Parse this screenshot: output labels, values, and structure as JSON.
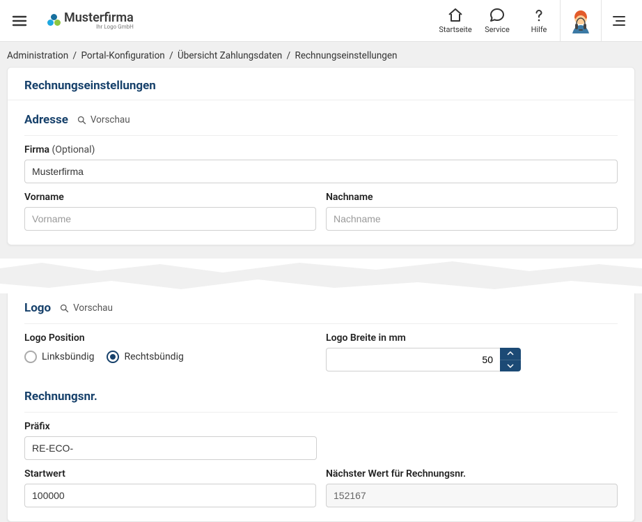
{
  "header": {
    "brand_name": "Musterfirma",
    "brand_sub": "Ihr Logo GmbH",
    "nav": {
      "home": "Startseite",
      "service": "Service",
      "help": "Hilfe"
    }
  },
  "breadcrumb": {
    "items": [
      "Administration",
      "Portal-Konfiguration",
      "Übersicht Zahlungsdaten",
      "Rechnungseinstellungen"
    ]
  },
  "page": {
    "title": "Rechnungseinstellungen",
    "preview_label": "Vorschau",
    "adresse": {
      "title": "Adresse",
      "firma_label": "Firma",
      "firma_optional": "(Optional)",
      "firma_value": "Musterfirma",
      "vorname_label": "Vorname",
      "vorname_placeholder": "Vorname",
      "nachname_label": "Nachname",
      "nachname_placeholder": "Nachname"
    },
    "logo": {
      "title": "Logo",
      "position_label": "Logo Position",
      "left_label": "Linksbündig",
      "right_label": "Rechtsbündig",
      "width_label": "Logo Breite in mm",
      "width_value": "50"
    },
    "rechnungsnr": {
      "title": "Rechnungsnr.",
      "prefix_label": "Präfix",
      "prefix_value": "RE-ECO-",
      "start_label": "Startwert",
      "start_value": "100000",
      "next_label": "Nächster Wert für Rechnungsnr.",
      "next_value": "152167"
    }
  }
}
